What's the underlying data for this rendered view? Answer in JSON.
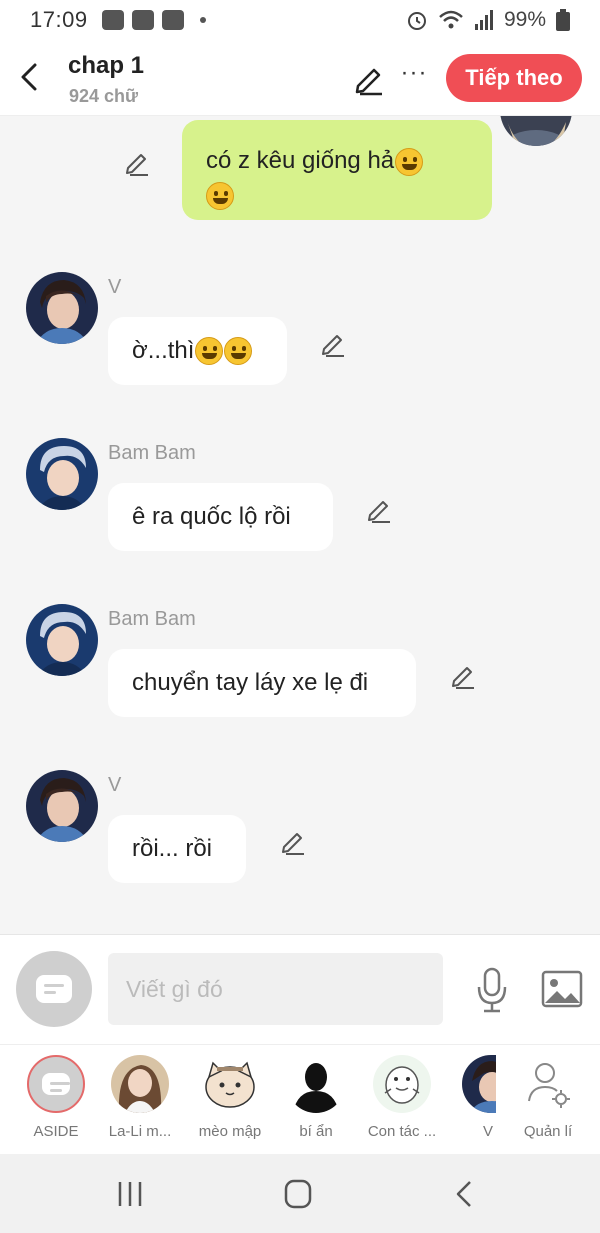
{
  "status_bar": {
    "time": "17:09",
    "battery": "99%"
  },
  "header": {
    "title": "chap 1",
    "subtitle": "924 chữ",
    "more_label": "···",
    "next_label": "Tiếp theo"
  },
  "messages": [
    {
      "sender": "",
      "text": "có z kêu giống hả",
      "mine": true
    },
    {
      "sender": "V",
      "text": "ờ...thì"
    },
    {
      "sender": "Bam Bam",
      "text": "ê ra quốc lộ rồi"
    },
    {
      "sender": "Bam Bam",
      "text": "chuyển tay láy xe lẹ đi"
    },
    {
      "sender": "V",
      "text": "rồi... rồi"
    }
  ],
  "input": {
    "placeholder": "Viết gì đó"
  },
  "characters": [
    {
      "label": "ASIDE"
    },
    {
      "label": "La-Li m..."
    },
    {
      "label": "mèo mập"
    },
    {
      "label": "bí ẩn"
    },
    {
      "label": "Con tác ..."
    },
    {
      "label": "V"
    },
    {
      "label": "Quản lí"
    }
  ],
  "colors": {
    "accent": "#f04e55",
    "my_bubble": "#d7f28c",
    "background": "#f5f5f5"
  }
}
